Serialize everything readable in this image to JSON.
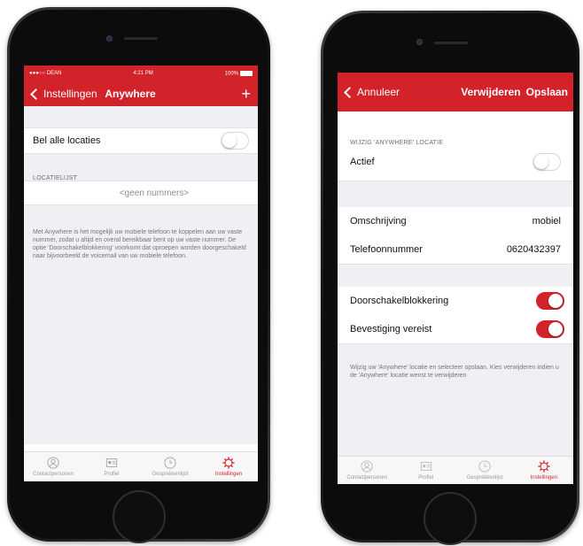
{
  "left_screen": {
    "status": {
      "carrier": "●●●○○ DEAN",
      "time": "4:21 PM",
      "battery": "100%"
    },
    "nav": {
      "back_label": "Instellingen",
      "title": "Anywhere",
      "add_label": "+"
    },
    "bel_alle_locaties": {
      "label": "Bel alle locaties",
      "toggle_on": false
    },
    "locatielijst": {
      "header": "LOCATIELIJST",
      "empty_text": "<geen nummers>"
    },
    "info_text": "Met Anywhere is het mogelijk uw mobiele telefoon te koppelen aan uw vaste nummer, zodat u altijd en overal bereikbaar bent op uw vaste nummer. De optie 'Doorschakelblokkering' voorkomt dat oproepen worden doorgeschakeld naar bijvoorbeeld de voicemail van uw mobiele telefoon.",
    "tabs": [
      {
        "label": "Contactpersonen",
        "icon": "person-icon",
        "active": false
      },
      {
        "label": "Profiel",
        "icon": "id-card-icon",
        "active": false
      },
      {
        "label": "Gesprekkenlijst",
        "icon": "clock-icon",
        "active": false
      },
      {
        "label": "Instellingen",
        "icon": "gear-icon",
        "active": true
      }
    ]
  },
  "right_screen": {
    "nav": {
      "back_label": "Annuleer",
      "delete_label": "Verwijderen",
      "save_label": "Opslaan"
    },
    "section_header": "WIJZIG 'ANYWHERE' LOCATIE",
    "actief": {
      "label": "Actief",
      "toggle_on": false
    },
    "omschrijving": {
      "label": "Omschrijving",
      "value": "mobiel"
    },
    "telefoonnummer": {
      "label": "Telefoonnummer",
      "value": "0620432397"
    },
    "doorschakelblokkering": {
      "label": "Doorschakelblokkering",
      "toggle_on": true
    },
    "bevestiging": {
      "label": "Bevestiging vereist",
      "toggle_on": true
    },
    "help_text": "Wijzig uw 'Anywhere' locatie en selecteer opslaan. Kies verwijderen indien u de 'Anywhere' locatie wenst te verwijderen",
    "tabs": [
      {
        "label": "Contactpersonen",
        "icon": "person-icon",
        "active": false
      },
      {
        "label": "Profiel",
        "icon": "id-card-icon",
        "active": false
      },
      {
        "label": "Gesprekkenlijst",
        "icon": "clock-icon",
        "active": false
      },
      {
        "label": "Instellingen",
        "icon": "gear-icon",
        "active": true
      }
    ]
  },
  "colors": {
    "accent": "#d2232a",
    "group_bg": "#efeff4",
    "tab_inactive": "#9a9a9a"
  }
}
